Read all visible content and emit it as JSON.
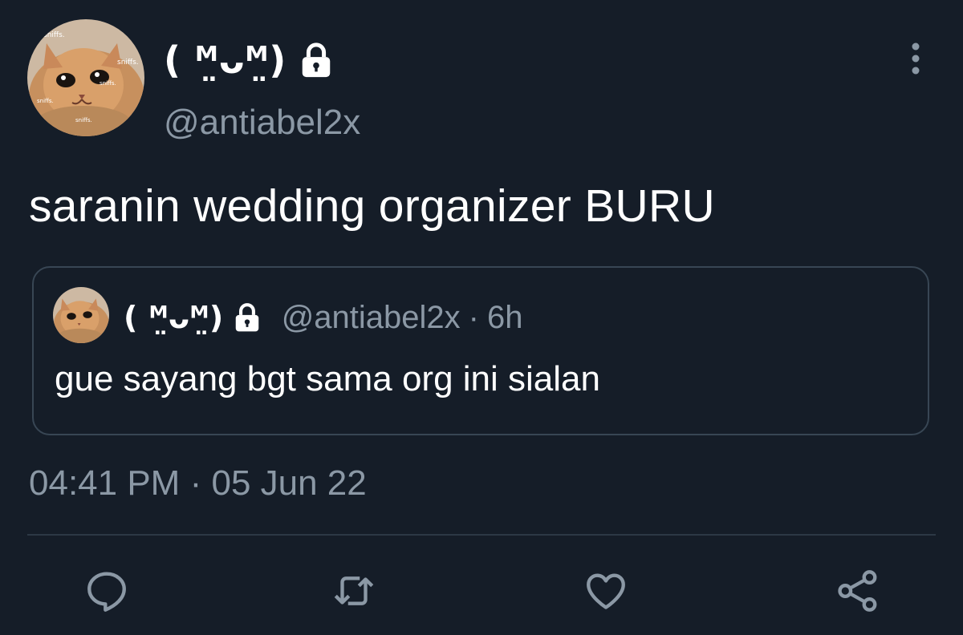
{
  "author": {
    "display_name": "( ᴹ̤ᴗᴹ̤)",
    "handle": "@antiabel2x",
    "protected": true,
    "avatar_caption": "sniffs."
  },
  "tweet": {
    "text": "saranin wedding organizer BURU",
    "time": "04:41 PM",
    "separator": "·",
    "date": "05 Jun 22"
  },
  "quoted_tweet": {
    "display_name": "( ᴹ̤ᴗᴹ̤)",
    "handle": "@antiabel2x",
    "separator": "·",
    "relative_time": "6h",
    "text": "gue sayang bgt sama org ini sialan"
  },
  "actions": {
    "icons": [
      "reply-icon",
      "retweet-icon",
      "like-icon",
      "share-icon"
    ]
  },
  "theme": {
    "background": "#151d28",
    "secondary_text": "#8b98a5",
    "border": "#384654",
    "icon": "#8b98a5"
  }
}
